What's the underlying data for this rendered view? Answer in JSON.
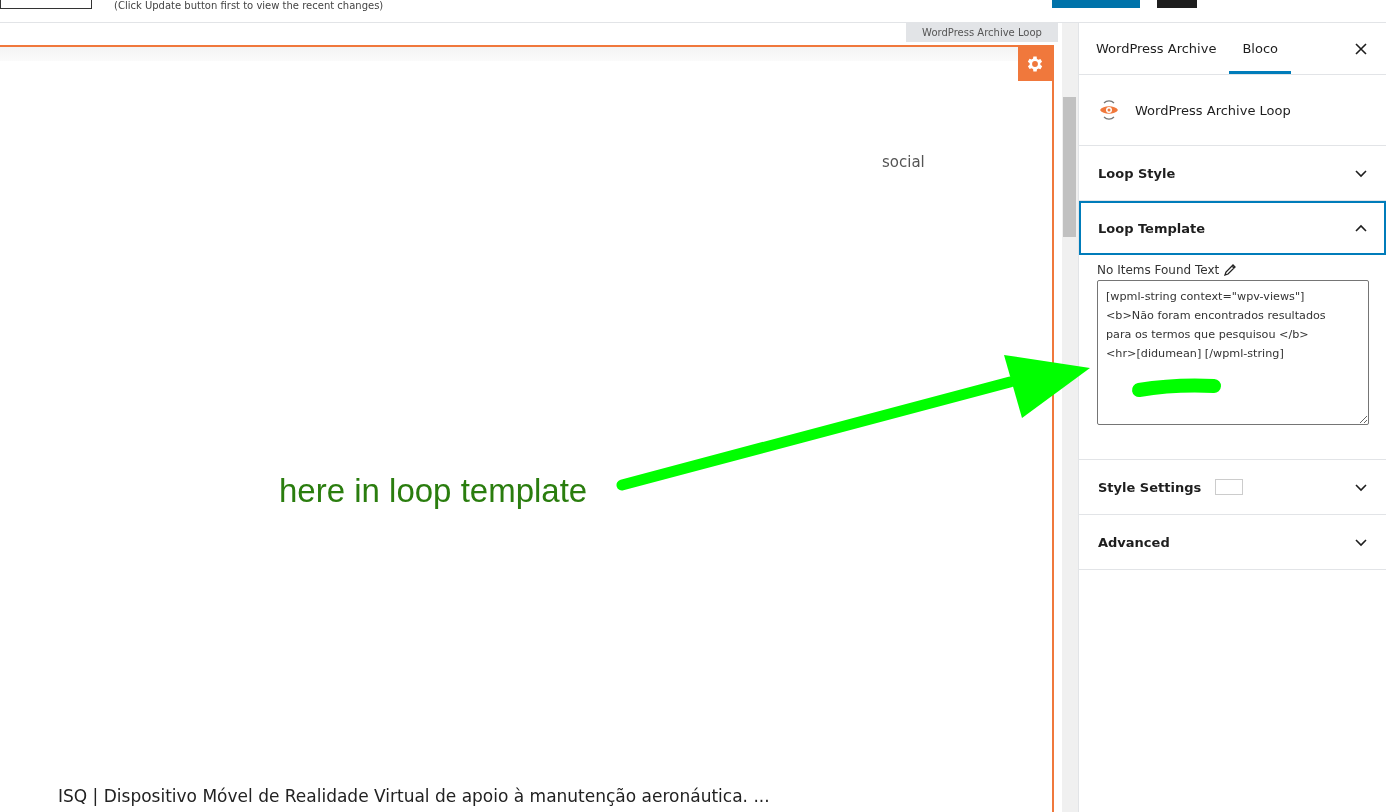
{
  "top_bar": {
    "note": "(Click Update button first to view the recent changes)"
  },
  "canvas": {
    "block_label": "WordPress Archive Loop",
    "social": "social",
    "post_title": "ISQ | Dispositivo Móvel de Realidade Virtual de apoio à manutenção aeronáutica. ..."
  },
  "annotation": {
    "text": "here in loop template"
  },
  "sidebar": {
    "tabs": [
      {
        "label": "WordPress Archive",
        "selected": false
      },
      {
        "label": "Bloco",
        "selected": true
      }
    ],
    "block": {
      "title": "WordPress Archive Loop"
    },
    "panels": [
      {
        "title": "Loop Style",
        "expanded": false
      },
      {
        "title": "Loop Template",
        "expanded": true,
        "field": {
          "label": "No Items Found Text",
          "value": "[wpml-string context=\"wpv-views\"]\n<b>Não foram encontrados resultados\npara os termos que pesquisou </b>\n<hr>[didumean] [/wpml-string]"
        }
      },
      {
        "title": "Style Settings",
        "expanded": false,
        "swatch": true
      },
      {
        "title": "Advanced",
        "expanded": false
      }
    ]
  }
}
